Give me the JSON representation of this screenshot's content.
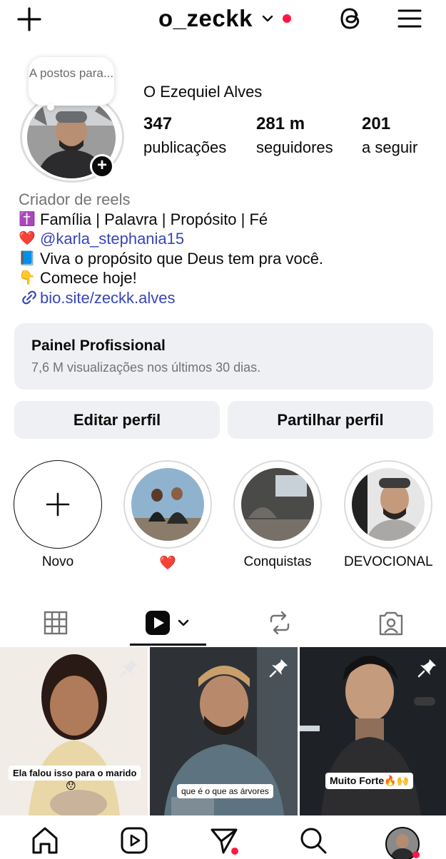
{
  "header": {
    "username": "o_zeckk"
  },
  "note": {
    "text": "A postos para..."
  },
  "profile": {
    "full_name": "O Ezequiel Alves",
    "stats": [
      {
        "value": "347",
        "label": "publicações"
      },
      {
        "value": "281 m",
        "label": "seguidores"
      },
      {
        "value": "201",
        "label": "a seguir"
      }
    ],
    "category": "Criador de reels",
    "bio_lines": [
      {
        "emoji": "✝️",
        "text": "Família | Palavra | Propósito | Fé"
      },
      {
        "emoji": "❤️",
        "text": "@karla_stephania15"
      },
      {
        "emoji": "📘",
        "text": "Viva o propósito que Deus tem pra você."
      },
      {
        "emoji": "👇",
        "text": "Comece hoje!"
      }
    ],
    "link": "bio.site/zeckk.alves"
  },
  "panel": {
    "title": "Painel Profissional",
    "subtitle": "7,6 M visualizações nos últimos 30 dias."
  },
  "buttons": {
    "edit": "Editar perfil",
    "share": "Partilhar perfil"
  },
  "highlights": [
    {
      "label": "Novo"
    },
    {
      "label": "❤️"
    },
    {
      "label": "Conquistas"
    },
    {
      "label": "DEVOCIONAL"
    }
  ],
  "grid": [
    {
      "caption": "Ela falou isso para o marido",
      "caption_emoji": "😯"
    },
    {
      "caption": "que é o que as árvores"
    },
    {
      "caption": "Muito Forte🔥🙌"
    }
  ],
  "colors": {
    "accent_link": "#3845b8",
    "notification": "#ff1744",
    "panel_bg": "#eff0f3"
  }
}
